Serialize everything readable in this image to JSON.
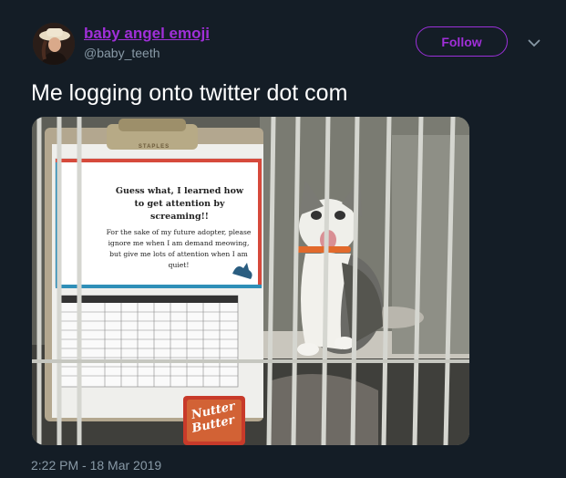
{
  "user": {
    "display_name": "baby angel emoji",
    "handle": "@baby_teeth"
  },
  "actions": {
    "follow_label": "Follow",
    "more_icon": "chevron-down-icon"
  },
  "tweet": {
    "text": "Me logging onto twitter dot com",
    "timestamp": "2:22 PM - 18 Mar 2019"
  },
  "photo": {
    "clipboard_brand": "STAPLES",
    "sign_headline": "Guess what, I learned how to get attention by screaming!!",
    "sign_body": "For the sake of my future adopter, please ignore me when I am demand meowing, but give me lots of attention when I am quiet!",
    "snack_brand_line1": "Nutter",
    "snack_brand_line2": "Butter"
  },
  "colors": {
    "background": "#141d26",
    "accent": "#a02fd8",
    "secondary_text": "#8899a6"
  }
}
